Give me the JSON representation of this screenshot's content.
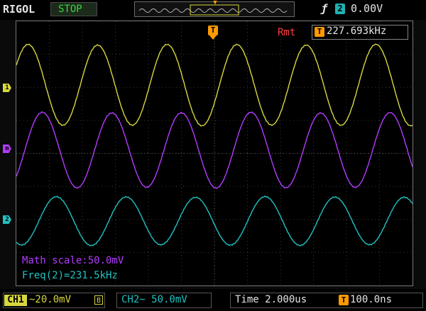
{
  "header": {
    "brand": "RIGOL",
    "run_state": "STOP",
    "trigger_channel": "2",
    "trigger_level": "0.00V"
  },
  "screen": {
    "trigger_marker": "T",
    "remote_label": "Rmt",
    "freq_marker": "T",
    "freq_counter": "227.693kHz",
    "ch1_marker": "1",
    "math_marker": "m",
    "ch2_marker": "2",
    "math_scale": "Math scale:50.0mV",
    "freq_measure": "Freq(2)=231.5kHz"
  },
  "footer": {
    "ch1_label": "CH1",
    "ch1_scale": "~20.0mV",
    "ch1_bw": "B",
    "ch2_scale": "CH2~ 50.0mV",
    "timebase": "Time 2.000us",
    "trig_offset_marker": "T",
    "trig_offset": "100.0ns"
  },
  "colors": {
    "ch1": "#d6d640",
    "math": "#b23cff",
    "ch2": "#20c2c2",
    "trigger": "#ff9a00",
    "grid": "#3a3a3a"
  }
}
